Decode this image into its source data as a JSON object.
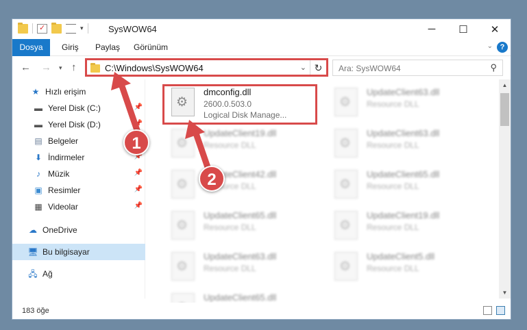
{
  "window": {
    "title": "SysWOW64"
  },
  "ribbon": {
    "tabs": [
      "Dosya",
      "Giriş",
      "Paylaş",
      "Görünüm"
    ]
  },
  "address": {
    "path": "C:\\Windows\\SysWOW64",
    "search_placeholder": "Ara: SysWOW64"
  },
  "sidebar": {
    "items": [
      {
        "label": "Hızlı erişim",
        "icon": "star-icon",
        "pinned": false
      },
      {
        "label": "Yerel Disk (C:)",
        "icon": "drive-icon",
        "pinned": true
      },
      {
        "label": "Yerel Disk (D:)",
        "icon": "drive-icon",
        "pinned": true
      },
      {
        "label": "Belgeler",
        "icon": "document-icon",
        "pinned": true
      },
      {
        "label": "İndirmeler",
        "icon": "download-icon",
        "pinned": true
      },
      {
        "label": "Müzik",
        "icon": "music-icon",
        "pinned": true
      },
      {
        "label": "Resimler",
        "icon": "pictures-icon",
        "pinned": true
      },
      {
        "label": "Videolar",
        "icon": "video-icon",
        "pinned": true
      },
      {
        "label": "OneDrive",
        "icon": "cloud-icon",
        "pinned": false
      },
      {
        "label": "Bu bilgisayar",
        "icon": "computer-icon",
        "pinned": false
      },
      {
        "label": "Ağ",
        "icon": "network-icon",
        "pinned": false
      }
    ]
  },
  "files": {
    "highlighted": {
      "name": "dmconfig.dll",
      "version": "2600.0.503.0",
      "description": "Logical Disk Manage..."
    },
    "blurred": [
      {
        "name": "UpdateClient63.dll",
        "type": "Resource DLL"
      },
      {
        "name": "UpdateClient63.dll",
        "type": "Resource DLL"
      },
      {
        "name": "UpdateClient19.dll",
        "type": "Resource DLL"
      },
      {
        "name": "UpdateClient65.dll",
        "type": "Resource DLL"
      },
      {
        "name": "UpdateClient42.dll",
        "type": "Resource DLL"
      },
      {
        "name": "UpdateClient65.dll",
        "type": "Resource DLL"
      },
      {
        "name": "UpdateClient65.dll",
        "type": "Resource DLL"
      },
      {
        "name": "UpdateClient19.dll",
        "type": "Resource DLL"
      },
      {
        "name": "UpdateClient63.dll",
        "type": "Resource DLL"
      },
      {
        "name": "UpdateClient5.dll",
        "type": "Resource DLL"
      }
    ]
  },
  "status": {
    "item_count": "183 öğe"
  },
  "annotations": {
    "step1": "1",
    "step2": "2",
    "color": "#d84a4a"
  },
  "colors": {
    "accent": "#1979ca",
    "selection": "#cce4f7"
  }
}
